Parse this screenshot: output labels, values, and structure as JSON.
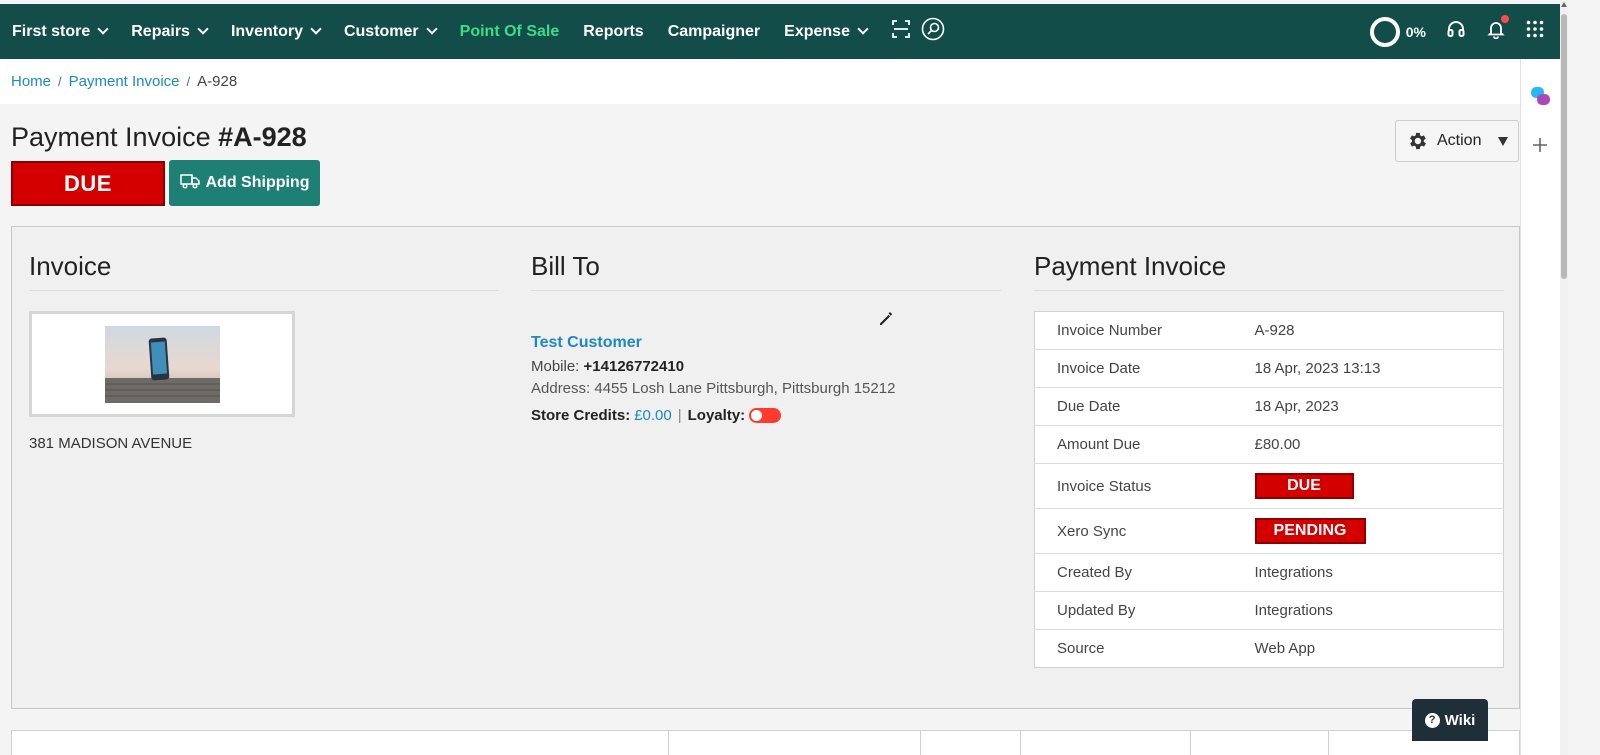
{
  "nav": {
    "items": [
      {
        "label": "First store",
        "dropdown": true
      },
      {
        "label": "Repairs",
        "dropdown": true
      },
      {
        "label": "Inventory",
        "dropdown": true
      },
      {
        "label": "Customer",
        "dropdown": true
      },
      {
        "label": "Point Of Sale",
        "dropdown": false,
        "active": true
      },
      {
        "label": "Reports",
        "dropdown": false
      },
      {
        "label": "Campaigner",
        "dropdown": false
      },
      {
        "label": "Expense",
        "dropdown": true
      }
    ],
    "progress_label": "0%",
    "colors": {
      "bar": "#134d4a",
      "active": "#3ddc84"
    }
  },
  "breadcrumb": {
    "home": "Home",
    "section": "Payment Invoice",
    "current": "A-928"
  },
  "header": {
    "title_prefix": "Payment Invoice ",
    "title_number": "#A-928",
    "status_badge": "DUE",
    "add_shipping": "Add Shipping",
    "action": "Action"
  },
  "invoice": {
    "heading": "Invoice",
    "store_address": "381 MADISON AVENUE"
  },
  "bill_to": {
    "heading": "Bill To",
    "customer_name": "Test Customer",
    "mobile_label": "Mobile: ",
    "mobile": "+14126772410",
    "address": "Address: 4455 Losh Lane Pittsburgh, Pittsburgh 15212",
    "store_credits_label": "Store Credits:",
    "store_credits": "£0.00",
    "separator": "|",
    "loyalty_label": "Loyalty:"
  },
  "payment_invoice": {
    "heading": "Payment Invoice",
    "rows": [
      {
        "key": "Invoice Number",
        "value": "A-928"
      },
      {
        "key": "Invoice Date",
        "value": "18 Apr, 2023 13:13"
      },
      {
        "key": "Due Date",
        "value": "18 Apr, 2023"
      },
      {
        "key": "Amount Due",
        "value": "£80.00"
      },
      {
        "key": "Invoice Status",
        "value": "DUE"
      },
      {
        "key": "Xero Sync",
        "value": "PENDING"
      },
      {
        "key": "Created By",
        "value": "Integrations"
      },
      {
        "key": "Updated By",
        "value": "Integrations"
      },
      {
        "key": "Source",
        "value": "Web App"
      }
    ]
  },
  "wiki": "Wiki",
  "colors": {
    "due_red": "#d40000",
    "teal_button": "#1e8074",
    "link": "#1e88c4"
  }
}
